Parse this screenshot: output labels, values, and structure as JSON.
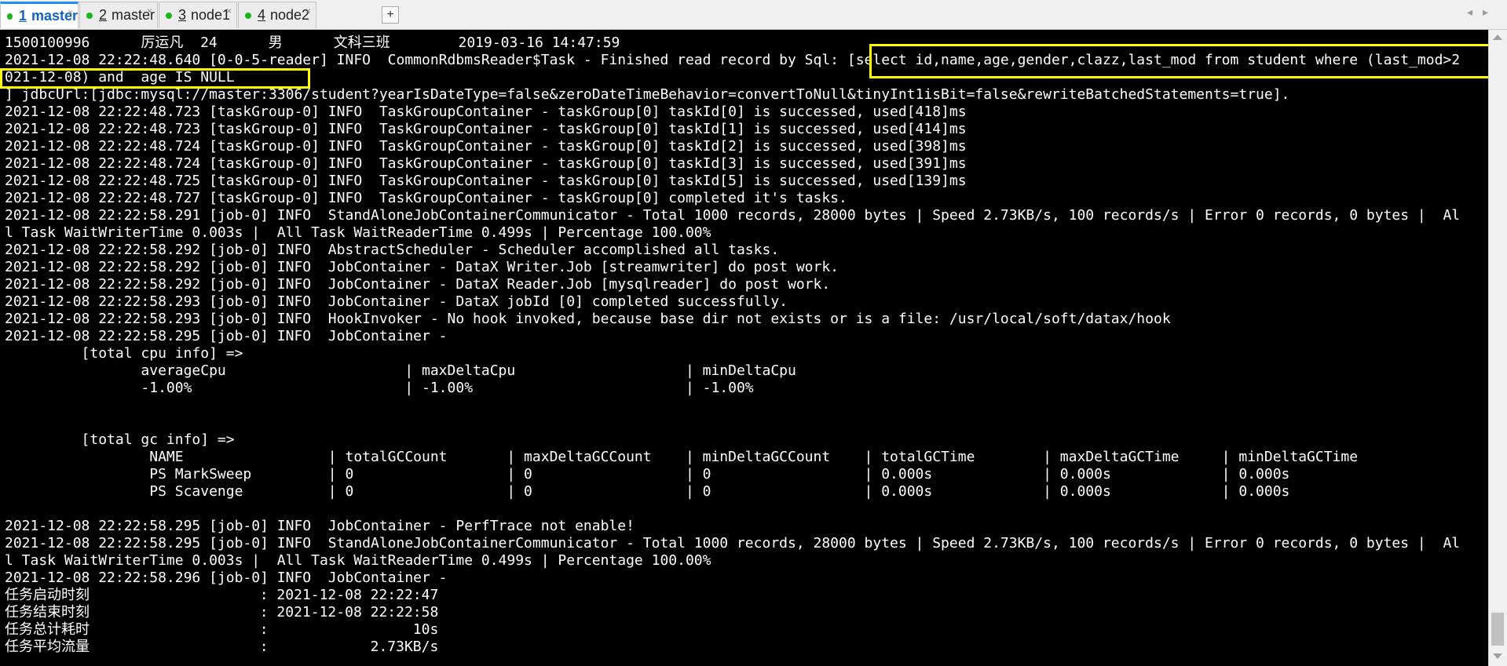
{
  "tabs": [
    {
      "num": "1",
      "name": "master",
      "active": true
    },
    {
      "num": "2",
      "name": "master",
      "active": false
    },
    {
      "num": "3",
      "name": "node1",
      "active": false
    },
    {
      "num": "4",
      "name": "node2",
      "active": false
    }
  ],
  "tab_close": "×",
  "tab_add": "+",
  "tab_nav": {
    "prev": "◂",
    "next": "▸"
  },
  "terminal": {
    "lines": [
      "1500100996      厉运凡  24      男      文科三班        2019-03-16 14:47:59",
      "2021-12-08 22:22:48.640 [0-0-5-reader] INFO  CommonRdbmsReader$Task - Finished read record by Sql: [select id,name,age,gender,clazz,last_mod from student where (last_mod>2",
      "021-12-08) and  age IS NULL",
      "] jdbcUrl:[jdbc:mysql://master:3306/student?yearIsDateType=false&zeroDateTimeBehavior=convertToNull&tinyInt1isBit=false&rewriteBatchedStatements=true].",
      "2021-12-08 22:22:48.723 [taskGroup-0] INFO  TaskGroupContainer - taskGroup[0] taskId[0] is successed, used[418]ms",
      "2021-12-08 22:22:48.723 [taskGroup-0] INFO  TaskGroupContainer - taskGroup[0] taskId[1] is successed, used[414]ms",
      "2021-12-08 22:22:48.724 [taskGroup-0] INFO  TaskGroupContainer - taskGroup[0] taskId[2] is successed, used[398]ms",
      "2021-12-08 22:22:48.724 [taskGroup-0] INFO  TaskGroupContainer - taskGroup[0] taskId[3] is successed, used[391]ms",
      "2021-12-08 22:22:48.725 [taskGroup-0] INFO  TaskGroupContainer - taskGroup[0] taskId[5] is successed, used[139]ms",
      "2021-12-08 22:22:48.727 [taskGroup-0] INFO  TaskGroupContainer - taskGroup[0] completed it's tasks.",
      "2021-12-08 22:22:58.291 [job-0] INFO  StandAloneJobContainerCommunicator - Total 1000 records, 28000 bytes | Speed 2.73KB/s, 100 records/s | Error 0 records, 0 bytes |  Al",
      "l Task WaitWriterTime 0.003s |  All Task WaitReaderTime 0.499s | Percentage 100.00%",
      "2021-12-08 22:22:58.292 [job-0] INFO  AbstractScheduler - Scheduler accomplished all tasks.",
      "2021-12-08 22:22:58.292 [job-0] INFO  JobContainer - DataX Writer.Job [streamwriter] do post work.",
      "2021-12-08 22:22:58.292 [job-0] INFO  JobContainer - DataX Reader.Job [mysqlreader] do post work.",
      "2021-12-08 22:22:58.293 [job-0] INFO  JobContainer - DataX jobId [0] completed successfully.",
      "2021-12-08 22:22:58.293 [job-0] INFO  HookInvoker - No hook invoked, because base dir not exists or is a file: /usr/local/soft/datax/hook",
      "2021-12-08 22:22:58.295 [job-0] INFO  JobContainer - ",
      "         [total cpu info] => ",
      "                averageCpu                     | maxDeltaCpu                    | minDeltaCpu                    ",
      "                -1.00%                         | -1.00%                         | -1.00%",
      "",
      "",
      "         [total gc info] => ",
      "                 NAME                 | totalGCCount       | maxDeltaGCCount    | minDeltaGCCount    | totalGCTime        | maxDeltaGCTime     | minDeltaGCTime     ",
      "                 PS MarkSweep         | 0                  | 0                  | 0                  | 0.000s             | 0.000s             | 0.000s             ",
      "                 PS Scavenge          | 0                  | 0                  | 0                  | 0.000s             | 0.000s             | 0.000s             ",
      "",
      "2021-12-08 22:22:58.295 [job-0] INFO  JobContainer - PerfTrace not enable!",
      "2021-12-08 22:22:58.295 [job-0] INFO  StandAloneJobContainerCommunicator - Total 1000 records, 28000 bytes | Speed 2.73KB/s, 100 records/s | Error 0 records, 0 bytes |  Al",
      "l Task WaitWriterTime 0.003s |  All Task WaitReaderTime 0.499s | Percentage 100.00%",
      "2021-12-08 22:22:58.296 [job-0] INFO  JobContainer - ",
      "任务启动时刻                    : 2021-12-08 22:22:47",
      "任务结束时刻                    : 2021-12-08 22:22:58",
      "任务总计耗时                    :                 10s",
      "任务平均流量                    :            2.73KB/s"
    ]
  },
  "colors": {
    "terminal_bg": "#000000",
    "terminal_fg": "#ffffff",
    "highlight": "#ffff00",
    "active_tab_accent": "#1e90ff",
    "connected_dot": "#1bb51b"
  }
}
